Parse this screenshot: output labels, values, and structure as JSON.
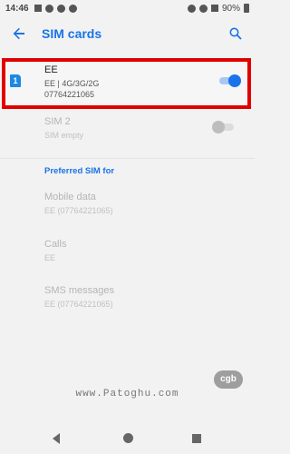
{
  "status_bar": {
    "time": "14:46",
    "battery": "90%"
  },
  "app_bar": {
    "title": "SIM cards"
  },
  "sim1": {
    "name": "EE",
    "network": "EE | 4G/3G/2G",
    "number": "07764221065",
    "slot_label": "1",
    "enabled": true
  },
  "sim2": {
    "name": "SIM 2",
    "status": "SIM empty",
    "enabled": false
  },
  "preferred": {
    "header": "Preferred SIM for",
    "items": [
      {
        "label": "Mobile data",
        "value": "EE (07764221065)"
      },
      {
        "label": "Calls",
        "value": "EE"
      },
      {
        "label": "SMS messages",
        "value": "EE (07764221065)"
      }
    ]
  },
  "watermark": {
    "logo_text": "cgb",
    "site": "www.Patoghu.com"
  },
  "colors": {
    "accent": "#1a73e8",
    "highlight_border": "#e10000"
  }
}
